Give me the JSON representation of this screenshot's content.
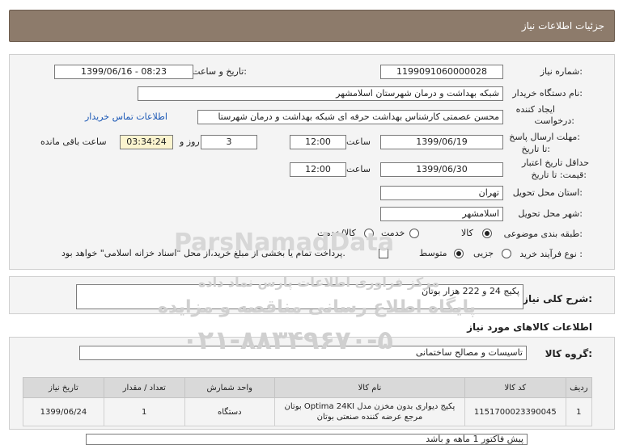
{
  "header": {
    "title": "جزئیات اطلاعات نیاز"
  },
  "form": {
    "need_number_label": "شماره نیاز:",
    "need_number": "1199091060000028",
    "announce_label": "تاریخ و ساعت اعلان عمومی:",
    "announce_value": "1399/06/16 - 08:23",
    "buyer_label": "نام دستگاه خریدار:",
    "buyer_value": "شبکه بهداشت و درمان شهرستان اسلامشهر",
    "creator_label_1": "ایجاد کننده",
    "creator_label_2": "درخواست:",
    "creator_value": "محسن عصمتی کارشناس بهداشت حرفه ای شبکه بهداشت و درمان شهرستا",
    "contact_link": "اطلاعات تماس خریدار",
    "deadline_label_1": "مهلت ارسال پاسخ:",
    "deadline_label_2": "تا تاریخ:",
    "deadline_date": "1399/06/19",
    "time_label": "ساعت",
    "deadline_time": "12:00",
    "days_value": "3",
    "days_label": "روز و",
    "remaining_time": "03:34:24",
    "remaining_label": "ساعت باقی مانده",
    "validity_label_1": "حداقل تاریخ اعتبار",
    "validity_label_2": "قیمت: تا تاریخ:",
    "validity_date": "1399/06/30",
    "validity_time": "12:00",
    "province_label": "استان محل تحویل:",
    "province_value": "تهران",
    "city_label": "شهر محل تحویل:",
    "city_value": "اسلامشهر",
    "category_label": "طبقه بندی موضوعی:",
    "category_options": [
      "کالا",
      "خدمت",
      "کالا/خدمت"
    ],
    "category_selected": "کالا",
    "process_label": "نوع فرآیند خرید :",
    "process_options": [
      "جزیی",
      "متوسط"
    ],
    "process_selected": "متوسط",
    "payment_note": "پرداخت تمام یا بخشی از مبلغ خرید،از محل \"اسناد خزانه اسلامی\" خواهد بود."
  },
  "description": {
    "label": "شرح کلی نیاز:",
    "value": "پکیج 24 و 222 هزار بوتان"
  },
  "goods": {
    "section_title": "اطلاعات کالاهای مورد نیاز",
    "group_label": "گروه کالا:",
    "group_value": "تاسیسات و مصالح ساختمانی",
    "columns": [
      "ردیف",
      "کد کالا",
      "نام کالا",
      "واحد شمارش",
      "تعداد / مقدار",
      "تاریخ نیاز"
    ],
    "rows": [
      {
        "row": "1",
        "code": "1151700023390045",
        "name": "پکیج دیواری بدون مخزن مدل Optima 24KI بوتان مرجع عرضه کننده صنعتی بوتان",
        "unit": "دستگاه",
        "qty": "1",
        "date": "1399/06/24"
      }
    ]
  },
  "footer_note": "پیش فاکتور 1 ماهه و باشد",
  "watermark": {
    "brand": "ParsNamadData",
    "line1": "مرکز فراوری اطلاعات پارس نماد داده",
    "line2": "پایگاه اطلاع رسانی مناقصه و مزایده",
    "phone": "۰۲۱-۸۸۳۴۹۶۷۰-۵"
  }
}
